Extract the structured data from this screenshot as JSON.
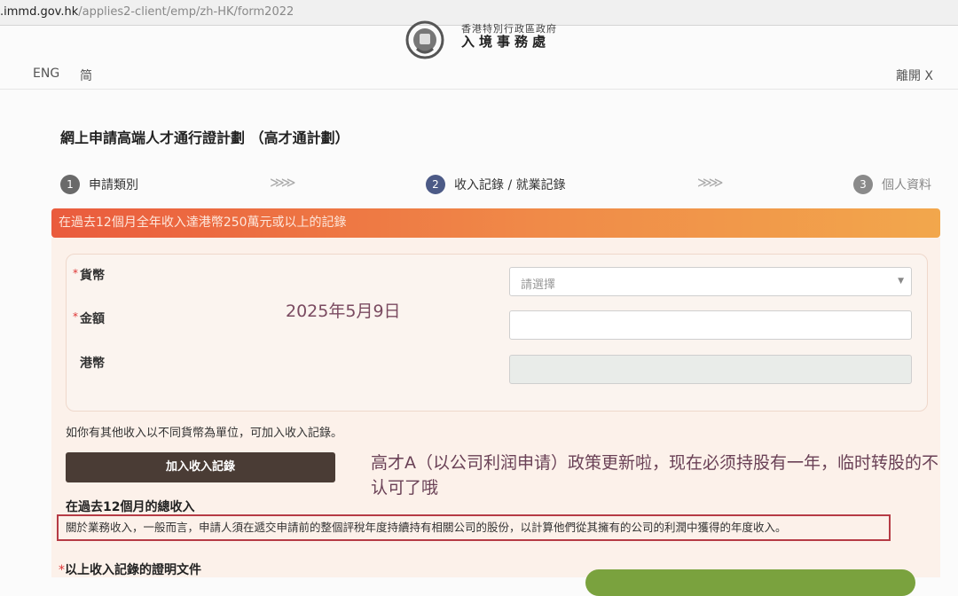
{
  "browser": {
    "url_host": ".immd.gov.hk",
    "url_path": "/applies2-client/emp/zh-HK/form2022"
  },
  "header": {
    "department_top": "香港特別行政區政府",
    "department": "入境事務處",
    "lang_english": "ENG",
    "lang_simplified": "简",
    "exit_label": "離開 X"
  },
  "form": {
    "title": "網上申請高端人才通行證計劃 （高才通計劃）",
    "steps": [
      {
        "number": "1",
        "label": "申請類別"
      },
      {
        "number": "2",
        "label": "收入記錄 / 就業記錄"
      },
      {
        "number": "3",
        "label": "個人資料"
      }
    ],
    "step_separator": "≫≫",
    "banner": "在過去12個月全年收入達港幣250萬元或以上的記錄",
    "currency_label": "貨幣",
    "currency_placeholder": "請選擇",
    "amount_label": "金額",
    "amount_value": "",
    "hkd_label": "港幣",
    "hkd_value": "",
    "required_mark": "*",
    "hint": "如你有其他收入以不同貨幣為單位，可加入收入記錄。",
    "add_record_button": "加入收入記錄",
    "total_income_title": "在過去12個月的總收入",
    "business_income_note": "關於業務收入，一般而言，申請人須在遞交申請前的整個評稅年度持續持有相關公司的股份，以計算他們從其擁有的公司的利潤中獲得的年度收入。",
    "proof_title": "以上收入記錄的證明文件"
  },
  "overlay": {
    "date_stamp": "2025年5月9日",
    "annotation": "高才A（以公司利润申请）政策更新啦，现在必须持股有一年，临时转股的不认可了哦"
  },
  "colors": {
    "banner_start": "#ea5b3d",
    "banner_end": "#f2a74c",
    "highlight_box": "#b63b45",
    "add_button": "#4a3c35",
    "active_step": "#4c5a86",
    "upload_button": "#7aa23e"
  },
  "icons": {
    "select_caret": "▼"
  }
}
